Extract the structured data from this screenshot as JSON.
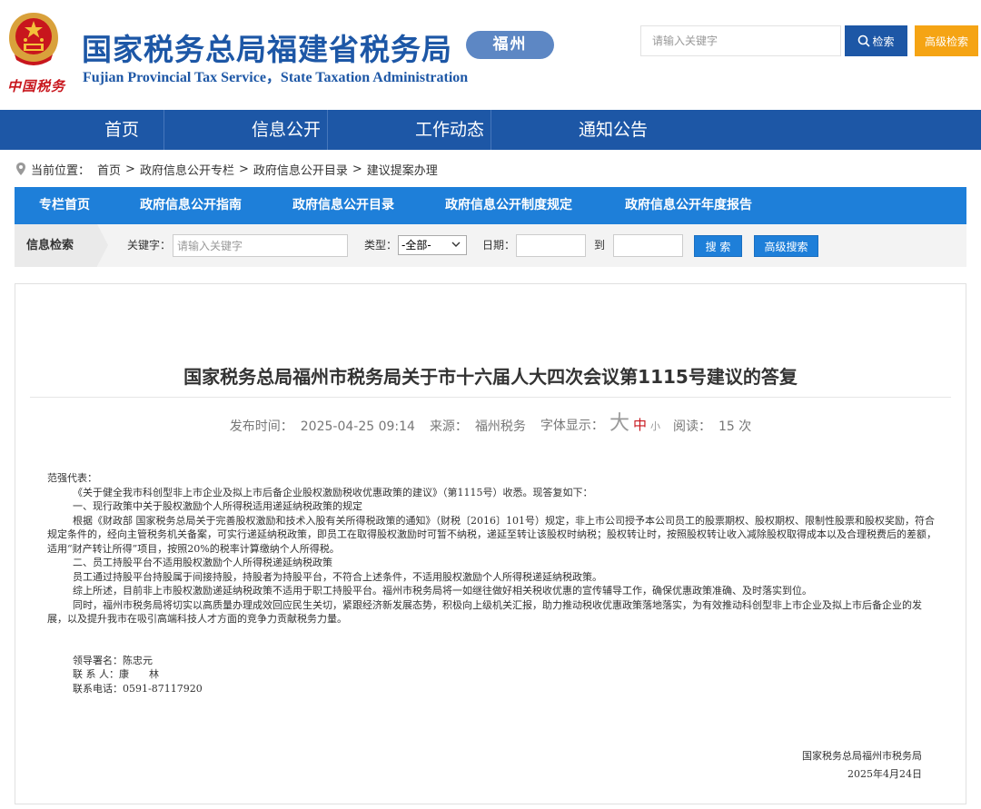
{
  "header": {
    "logo_text": "中国税务",
    "title": "国家税务总局福建省税务局",
    "subtitle": "Fujian Provincial Tax Service，State Taxation Administration",
    "city": "福州",
    "search_placeholder": "请输入关键字",
    "search_button": "检索",
    "advanced_button": "高级检索"
  },
  "main_nav": [
    "首页",
    "信息公开",
    "工作动态",
    "通知公告"
  ],
  "breadcrumb": {
    "prefix": "当前位置：",
    "items": [
      "首页",
      "政府信息公开专栏",
      "政府信息公开目录",
      "建议提案办理"
    ],
    "separator": ">"
  },
  "column_nav": [
    "专栏首页",
    "政府信息公开指南",
    "政府信息公开目录",
    "政府信息公开制度规定",
    "政府信息公开年度报告"
  ],
  "info_search": {
    "title": "信息检索",
    "keyword_label": "关键字：",
    "keyword_placeholder": "请输入关键字",
    "type_label": "类型：",
    "type_value": "-全部-",
    "date_label": "日期：",
    "to_label": "到",
    "search_button": "搜 索",
    "advanced_button": "高级搜索"
  },
  "article": {
    "title": "国家税务总局福州市税务局关于市十六届人大四次会议第1115号建议的答复",
    "publish_label": "发布时间：",
    "publish_time": "2025-04-25 09:14",
    "source_label": "来源：",
    "source": "福州税务",
    "font_label": "字体显示：",
    "font_big": "大",
    "font_mid": "中",
    "font_small": "小",
    "read_label": "阅读：",
    "read_count": "15 次",
    "paragraphs": [
      "范强代表：",
      "《关于健全我市科创型非上市企业及拟上市后备企业股权激励税收优惠政策的建议》（第1115号）收悉。现答复如下：",
      "一、现行政策中关于股权激励个人所得税适用递延纳税政策的规定",
      "根据《财政部 国家税务总局关于完善股权激励和技术入股有关所得税政策的通知》（财税〔2016〕101号）规定，非上市公司授予本公司员工的股票期权、股权期权、限制性股票和股权奖励，符合规定条件的，经向主管税务机关备案，可实行递延纳税政策，即员工在取得股权激励时可暂不纳税，递延至转让该股权时纳税；股权转让时，按照股权转让收入减除股权取得成本以及合理税费后的差额，适用“财产转让所得”项目，按照20%的税率计算缴纳个人所得税。",
      "二、员工持股平台不适用股权激励个人所得税递延纳税政策",
      "员工通过持股平台持股属于间接持股，持股者为持股平台，不符合上述条件，不适用股权激励个人所得税递延纳税政策。",
      "综上所述，目前非上市股权激励递延纳税政策不适用于职工持股平台。福州市税务局将一如继往做好相关税收优惠的宣传辅导工作，确保优惠政策准确、及时落实到位。",
      "同时，福州市税务局将切实以高质量办理成效回应民生关切，紧跟经济新发展态势，积极向上级机关汇报，助力推动税收优惠政策落地落实，为有效推动科创型非上市企业及拟上市后备企业的发展，以及提升我市在吸引高端科技人才方面的竞争力贡献税务力量。"
    ],
    "contacts": [
      "领导署名：陈忠元",
      "联 系 人：康　　林",
      "联系电话：0591-87117920"
    ],
    "signature_org": "国家税务总局福州市税务局",
    "signature_date": "2025年4月24日"
  },
  "colors": {
    "brand_blue": "#1d57a6",
    "column_blue": "#1e7fd9",
    "orange": "#f5a414",
    "red": "#c8161d"
  },
  "icons": [
    "national-emblem-icon",
    "search-icon",
    "location-pin-icon",
    "chevron-down-icon"
  ]
}
